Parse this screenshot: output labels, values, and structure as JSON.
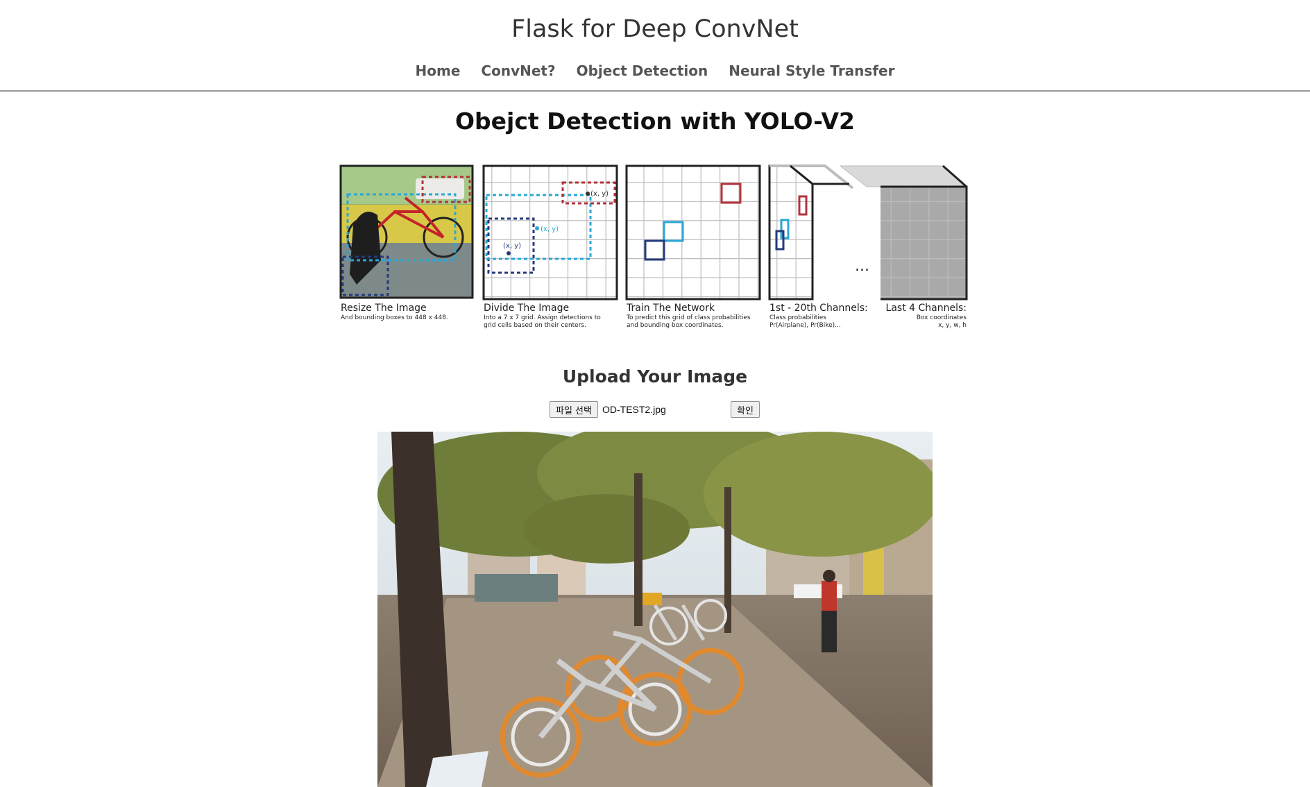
{
  "site_title": "Flask for Deep ConvNet",
  "nav": [
    "Home",
    "ConvNet?",
    "Object Detection",
    "Neural Style Transfer"
  ],
  "page_heading": "Obejct Detection with YOLO-V2",
  "diagram": {
    "panels": [
      {
        "title": "Resize The Image",
        "desc1": "And bounding boxes to 448 x 448.",
        "desc2": ""
      },
      {
        "title": "Divide The Image",
        "desc1": "Into a 7 x 7 grid. Assign detections to",
        "desc2": "grid cells based on their centers."
      },
      {
        "title": "Train The Network",
        "desc1": "To predict this grid of class probabilities",
        "desc2": "and bounding box coordinates."
      },
      {
        "title": "1st - 20th Channels:",
        "desc1": "Class probabilities",
        "desc2": "Pr(Airplane), Pr(Bike)..."
      },
      {
        "title": "Last 4 Channels:",
        "desc1": "Box coordinates",
        "desc2": "x, y, w, h"
      }
    ],
    "grid_labels": [
      "(x, y)",
      "(x, y)",
      "(x, y)"
    ],
    "ellipsis": "..."
  },
  "upload": {
    "heading": "Upload Your Image",
    "choose_file_label": "파일 선택",
    "file_name": "OD-TEST2.jpg",
    "submit_label": "확인"
  },
  "photo_icon": "street-scene-photo",
  "colors": {
    "accent_blue": "#29a7d6",
    "navy": "#253a7a",
    "red": "#b2333a"
  }
}
